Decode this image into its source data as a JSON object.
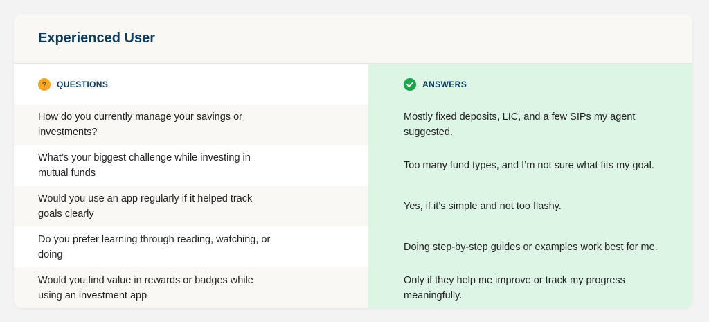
{
  "card": {
    "title": "Experienced User"
  },
  "questions": {
    "header": "QUESTIONS",
    "icon": "question-circle-icon",
    "icon_color": "#f5a623"
  },
  "answers": {
    "header": "ANSWERS",
    "icon": "check-circle-icon",
    "icon_color": "#1ea34a",
    "background": "#dcf5e5"
  },
  "rows": [
    {
      "question": "How do you currently manage your savings or investments?",
      "answer": "Mostly fixed deposits, LIC, and a few SIPs my agent suggested."
    },
    {
      "question": "What’s your biggest challenge while investing in mutual funds",
      "answer": "Too many fund types, and I’m not sure what fits my goal."
    },
    {
      "question": "Would you use an app regularly if it helped track goals clearly",
      "answer": "Yes, if it’s simple and not too flashy."
    },
    {
      "question": "Do you prefer learning through reading, watching, or doing",
      "answer": "Doing step-by-step guides or examples work best for me."
    },
    {
      "question": "Would you find value in rewards or badges while using an investment app",
      "answer": "Only if they help me improve or track my progress meaningfully."
    }
  ]
}
